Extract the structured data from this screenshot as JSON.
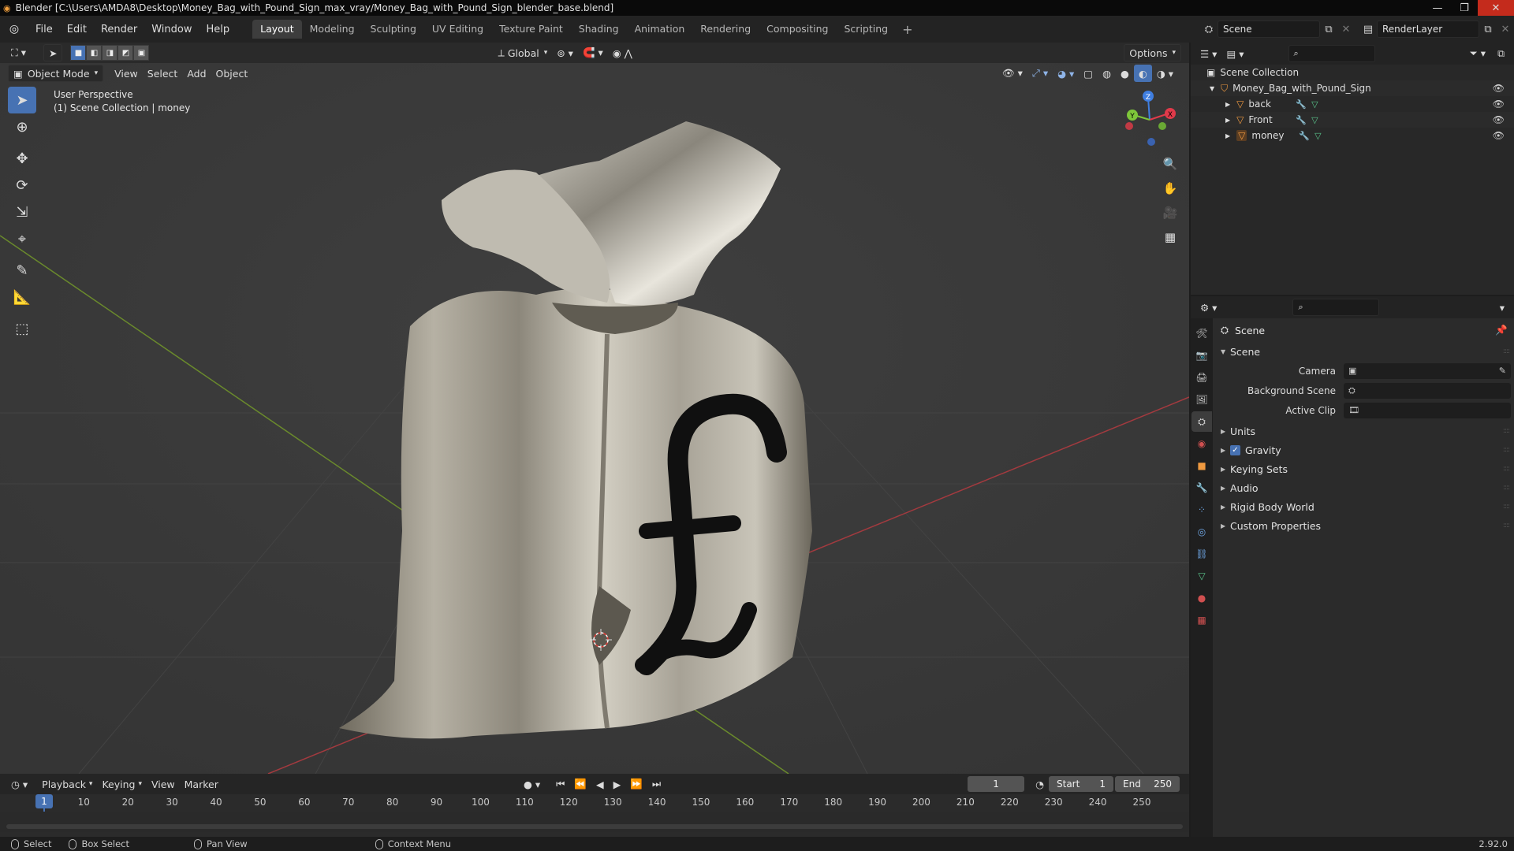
{
  "window": {
    "title": "Blender [C:\\Users\\AMDA8\\Desktop\\Money_Bag_with_Pound_Sign_max_vray/Money_Bag_with_Pound_Sign_blender_base.blend]"
  },
  "menu": [
    "File",
    "Edit",
    "Render",
    "Window",
    "Help"
  ],
  "workspaces": [
    "Layout",
    "Modeling",
    "Sculpting",
    "UV Editing",
    "Texture Paint",
    "Shading",
    "Animation",
    "Rendering",
    "Compositing",
    "Scripting"
  ],
  "active_workspace": "Layout",
  "scene_name": "Scene",
  "render_layer": "RenderLayer",
  "viewport": {
    "transform_orientation": "Global",
    "options_label": "Options",
    "mode": "Object Mode",
    "menus": [
      "View",
      "Select",
      "Add",
      "Object"
    ],
    "info_line1": "User Perspective",
    "info_line2": "(1) Scene Collection | money",
    "gizmo_axes": [
      "X",
      "Y",
      "Z"
    ]
  },
  "outliner": {
    "root": "Scene Collection",
    "collection": "Money_Bag_with_Pound_Sign",
    "objects": [
      "back",
      "Front",
      "money"
    ]
  },
  "properties": {
    "context": "Scene",
    "panel_title": "Scene",
    "camera_label": "Camera",
    "background_scene_label": "Background Scene",
    "active_clip_label": "Active Clip",
    "panels": [
      "Units",
      "Gravity",
      "Keying Sets",
      "Audio",
      "Rigid Body World",
      "Custom Properties"
    ],
    "gravity_checked": true
  },
  "timeline": {
    "menus": [
      "Playback",
      "Keying",
      "View",
      "Marker"
    ],
    "current_frame": "1",
    "start_label": "Start",
    "start_value": "1",
    "end_label": "End",
    "end_value": "250",
    "ticks": [
      "1",
      "10",
      "20",
      "30",
      "40",
      "50",
      "60",
      "70",
      "80",
      "90",
      "100",
      "110",
      "120",
      "130",
      "140",
      "150",
      "160",
      "170",
      "180",
      "190",
      "200",
      "210",
      "220",
      "230",
      "240",
      "250"
    ]
  },
  "statusbar": {
    "items": [
      "Select",
      "Box Select",
      "Pan View",
      "Context Menu"
    ],
    "version": "2.92.0"
  },
  "colors": {
    "accent": "#4772b3",
    "x_axis": "#e03a4a",
    "y_axis": "#7ec63a",
    "z_axis": "#3f7ee0",
    "object_orange": "#f09a40"
  }
}
